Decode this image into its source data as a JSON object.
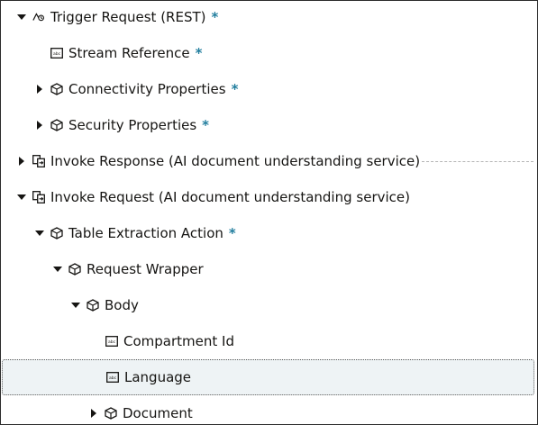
{
  "colors": {
    "required_marker": "#227e9e",
    "selected_background": "#eef3f5",
    "text": "#161513"
  },
  "tree": {
    "nodes": [
      {
        "label": "Trigger Request (REST)",
        "required": "*",
        "icon": "trigger-rest-icon",
        "toggle": "expanded"
      },
      {
        "label": "Stream Reference",
        "required": "*",
        "icon": "string-field-icon",
        "toggle": "none"
      },
      {
        "label": "Connectivity Properties",
        "required": "*",
        "icon": "object-cube-icon",
        "toggle": "collapsed"
      },
      {
        "label": "Security Properties",
        "required": "*",
        "icon": "object-cube-icon",
        "toggle": "collapsed"
      },
      {
        "label": "Invoke Response (AI document understanding service)",
        "required": "",
        "icon": "invoke-icon",
        "toggle": "collapsed"
      },
      {
        "label": "Invoke Request (AI document understanding service)",
        "required": "",
        "icon": "invoke-icon",
        "toggle": "expanded"
      },
      {
        "label": "Table Extraction Action",
        "required": "*",
        "icon": "object-cube-icon",
        "toggle": "expanded"
      },
      {
        "label": "Request Wrapper",
        "required": "",
        "icon": "object-cube-icon",
        "toggle": "expanded"
      },
      {
        "label": "Body",
        "required": "",
        "icon": "object-cube-icon",
        "toggle": "expanded"
      },
      {
        "label": "Compartment Id",
        "required": "",
        "icon": "string-field-icon",
        "toggle": "none"
      },
      {
        "label": "Language",
        "required": "",
        "icon": "string-field-icon",
        "toggle": "none",
        "selected": true
      },
      {
        "label": "Document",
        "required": "",
        "icon": "object-cube-icon",
        "toggle": "collapsed"
      }
    ]
  }
}
